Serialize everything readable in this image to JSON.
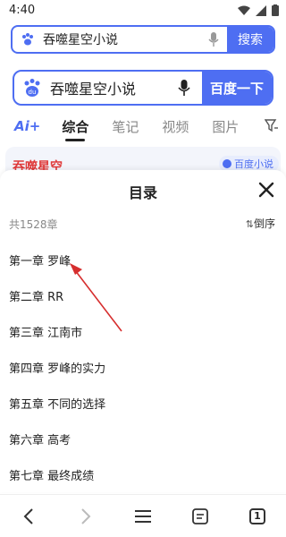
{
  "status_bar": {
    "time": "4:40"
  },
  "address_bar": {
    "query": "吞噬星空小说",
    "search_label": "搜索"
  },
  "baidu": {
    "query": "吞噬星空小说",
    "search_button": "百度一下"
  },
  "tabs": [
    {
      "label": "综合",
      "active": true
    },
    {
      "label": "笔记",
      "active": false
    },
    {
      "label": "视频",
      "active": false
    },
    {
      "label": "图片",
      "active": false
    }
  ],
  "ai_label": "Ai+",
  "result_peek": {
    "title": "吞噬星空",
    "badge": "百度小说"
  },
  "catalog": {
    "title": "目录",
    "count": "共1528章",
    "sort_label": "倒序",
    "chapters": [
      "第一章 罗峰",
      "第二章 RR",
      "第三章 江南市",
      "第四章 罗峰的实力",
      "第五章 不同的选择",
      "第六章 高考",
      "第七章 最终成绩"
    ]
  },
  "bottom_bar": {
    "tab_count": "1"
  },
  "colors": {
    "accent": "#4e6ef2",
    "annotation": "#d62e2e"
  }
}
